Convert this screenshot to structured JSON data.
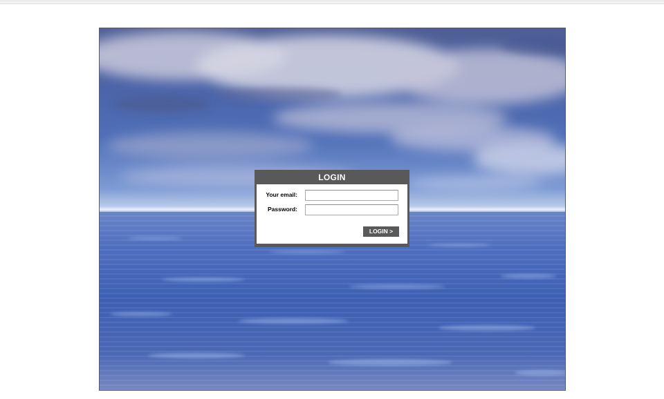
{
  "login": {
    "title": "LOGIN",
    "email_label": "Your email:",
    "email_value": "",
    "password_label": "Password:",
    "password_value": "",
    "submit_label": "LOGIN >"
  },
  "colors": {
    "panel": "#595959",
    "panel_text": "#ffffff",
    "sky": "#4b63a6",
    "sea": "#3d5fb3"
  }
}
